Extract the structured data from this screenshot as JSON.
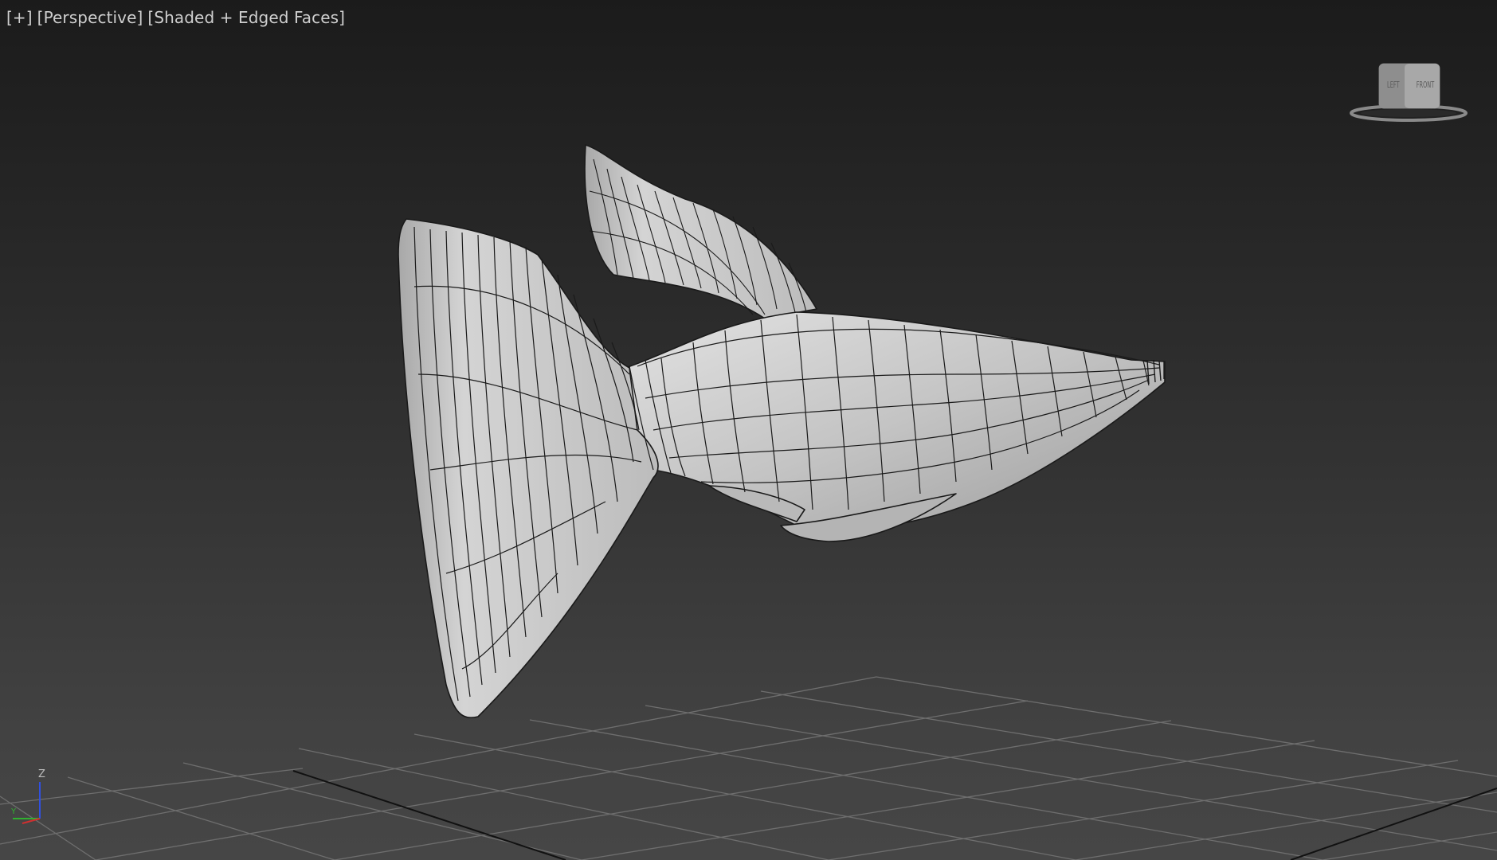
{
  "viewport": {
    "labels": {
      "menu": "[+]",
      "view": "[Perspective]",
      "shading": "[Shaded + Edged Faces]"
    },
    "viewcube": {
      "left_face": "LEFT",
      "front_face": "FRONT"
    },
    "axis": {
      "z": "Z",
      "y": "Y",
      "x": "X"
    }
  },
  "colors": {
    "background_top": "#1b1b1b",
    "background_bottom": "#464646",
    "mesh_fill": "#c9c9c9",
    "mesh_edge": "#1a1a1a",
    "grid_line": "#6a6a6a",
    "axis_x": "#d03030",
    "axis_y": "#30b030",
    "axis_z": "#3050e0"
  },
  "icons": [
    "viewcube-icon",
    "axis-tripod-icon"
  ]
}
